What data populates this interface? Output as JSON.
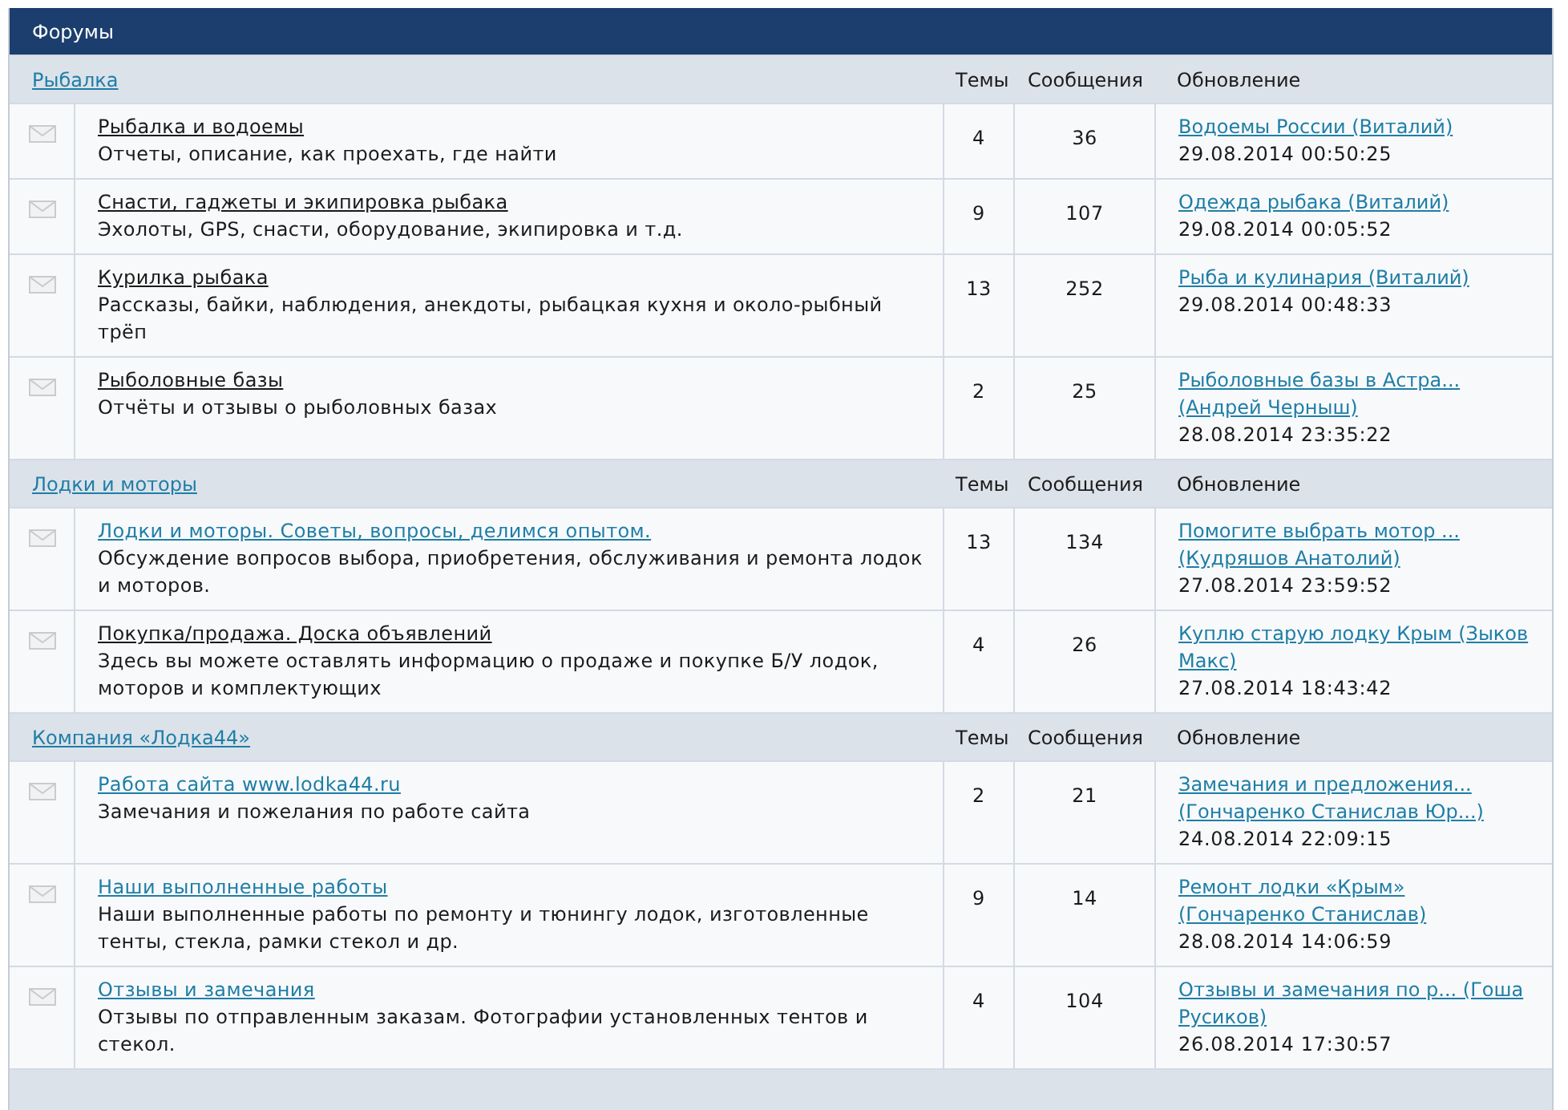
{
  "header": {
    "title": "Форумы"
  },
  "categories": [
    {
      "name": "Рыбалка",
      "columns": [
        "Темы",
        "Сообщения",
        "Обновление"
      ],
      "forums": [
        {
          "title": "Рыбалка и водоемы",
          "visited": true,
          "description": "Отчеты, описание, как проехать, где найти",
          "topics": "4",
          "posts": "36",
          "last_post": {
            "link": "Водоемы России (Виталий)",
            "date": "29.08.2014 00:50:25"
          }
        },
        {
          "title": "Снасти, гаджеты и экипировка рыбака",
          "visited": true,
          "description": "Эхолоты, GPS, снасти, оборудование, экипировка и т.д.",
          "topics": "9",
          "posts": "107",
          "last_post": {
            "link": "Одежда рыбака (Виталий)",
            "date": "29.08.2014 00:05:52"
          }
        },
        {
          "title": "Курилка рыбака",
          "visited": true,
          "description": "Рассказы, байки, наблюдения, анекдоты, рыбацкая кухня и около-рыбный трёп",
          "topics": "13",
          "posts": "252",
          "last_post": {
            "link": "Рыба и кулинария (Виталий)",
            "date": "29.08.2014 00:48:33"
          }
        },
        {
          "title": "Рыболовные базы",
          "visited": true,
          "description": "Отчёты и отзывы о рыболовных базах",
          "topics": "2",
          "posts": "25",
          "last_post": {
            "link": "Рыболовные базы в Астра... (Андрей Черныш)",
            "date": "28.08.2014 23:35:22"
          }
        }
      ]
    },
    {
      "name": "Лодки и моторы",
      "columns": [
        "Темы",
        "Сообщения",
        "Обновление"
      ],
      "forums": [
        {
          "title": "Лодки и моторы. Советы, вопросы, делимся опытом.",
          "visited": false,
          "description": "Обсуждение вопросов выбора, приобретения, обслуживания и ремонта лодок и моторов.",
          "topics": "13",
          "posts": "134",
          "last_post": {
            "link": "Помогите выбрать мотор ... (Кудряшов Анатолий)",
            "date": "27.08.2014 23:59:52"
          }
        },
        {
          "title": "Покупка/продажа. Доска объявлений",
          "visited": true,
          "description": "Здесь вы можете оставлять информацию о продаже и покупке Б/У лодок, моторов и комплектующих",
          "topics": "4",
          "posts": "26",
          "last_post": {
            "link": "Куплю старую лодку Крым (Зыков Макс)",
            "date": "27.08.2014 18:43:42"
          }
        }
      ]
    },
    {
      "name": "Компания «Лодка44»",
      "columns": [
        "Темы",
        "Сообщения",
        "Обновление"
      ],
      "forums": [
        {
          "title": "Работа сайта www.lodka44.ru",
          "visited": false,
          "description": "Замечания и пожелания по работе сайта",
          "topics": "2",
          "posts": "21",
          "last_post": {
            "link": "Замечания и предложения... (Гончаренко Станислав Юр...)",
            "date": "24.08.2014 22:09:15"
          }
        },
        {
          "title": "Наши выполненные работы",
          "visited": false,
          "description": "Наши выполненные работы по ремонту и тюнингу лодок, изготовленные тенты, стекла, рамки стекол и др.",
          "topics": "9",
          "posts": "14",
          "last_post": {
            "link": "Ремонт лодки «Крым» (Гончаренко Станислав)",
            "date": "28.08.2014 14:06:59"
          }
        },
        {
          "title": "Отзывы и замечания",
          "visited": false,
          "description": "Отзывы по отправленным заказам. Фотографии установленных тентов и стекол.",
          "topics": "4",
          "posts": "104",
          "last_post": {
            "link": "Отзывы и замечания по р... (Гоша Русиков)",
            "date": "26.08.2014 17:30:57"
          }
        }
      ]
    }
  ]
}
